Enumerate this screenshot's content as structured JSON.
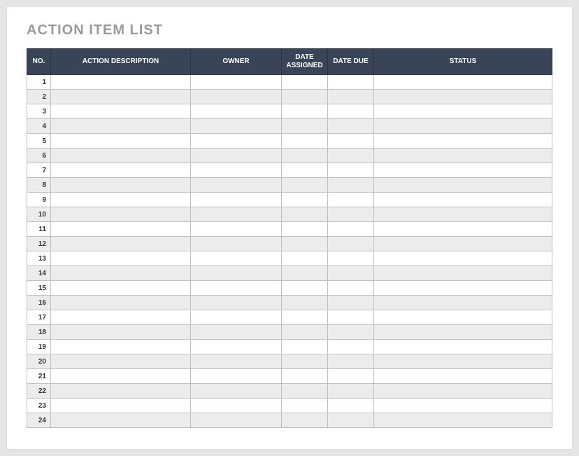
{
  "title": "ACTION ITEM LIST",
  "columns": {
    "no": "NO.",
    "description": "ACTION DESCRIPTION",
    "owner": "OWNER",
    "date_assigned": "DATE ASSIGNED",
    "date_due": "DATE DUE",
    "status": "STATUS"
  },
  "rows": [
    {
      "no": "1",
      "description": "",
      "owner": "",
      "date_assigned": "",
      "date_due": "",
      "status": ""
    },
    {
      "no": "2",
      "description": "",
      "owner": "",
      "date_assigned": "",
      "date_due": "",
      "status": ""
    },
    {
      "no": "3",
      "description": "",
      "owner": "",
      "date_assigned": "",
      "date_due": "",
      "status": ""
    },
    {
      "no": "4",
      "description": "",
      "owner": "",
      "date_assigned": "",
      "date_due": "",
      "status": ""
    },
    {
      "no": "5",
      "description": "",
      "owner": "",
      "date_assigned": "",
      "date_due": "",
      "status": ""
    },
    {
      "no": "6",
      "description": "",
      "owner": "",
      "date_assigned": "",
      "date_due": "",
      "status": ""
    },
    {
      "no": "7",
      "description": "",
      "owner": "",
      "date_assigned": "",
      "date_due": "",
      "status": ""
    },
    {
      "no": "8",
      "description": "",
      "owner": "",
      "date_assigned": "",
      "date_due": "",
      "status": ""
    },
    {
      "no": "9",
      "description": "",
      "owner": "",
      "date_assigned": "",
      "date_due": "",
      "status": ""
    },
    {
      "no": "10",
      "description": "",
      "owner": "",
      "date_assigned": "",
      "date_due": "",
      "status": ""
    },
    {
      "no": "11",
      "description": "",
      "owner": "",
      "date_assigned": "",
      "date_due": "",
      "status": ""
    },
    {
      "no": "12",
      "description": "",
      "owner": "",
      "date_assigned": "",
      "date_due": "",
      "status": ""
    },
    {
      "no": "13",
      "description": "",
      "owner": "",
      "date_assigned": "",
      "date_due": "",
      "status": ""
    },
    {
      "no": "14",
      "description": "",
      "owner": "",
      "date_assigned": "",
      "date_due": "",
      "status": ""
    },
    {
      "no": "15",
      "description": "",
      "owner": "",
      "date_assigned": "",
      "date_due": "",
      "status": ""
    },
    {
      "no": "16",
      "description": "",
      "owner": "",
      "date_assigned": "",
      "date_due": "",
      "status": ""
    },
    {
      "no": "17",
      "description": "",
      "owner": "",
      "date_assigned": "",
      "date_due": "",
      "status": ""
    },
    {
      "no": "18",
      "description": "",
      "owner": "",
      "date_assigned": "",
      "date_due": "",
      "status": ""
    },
    {
      "no": "19",
      "description": "",
      "owner": "",
      "date_assigned": "",
      "date_due": "",
      "status": ""
    },
    {
      "no": "20",
      "description": "",
      "owner": "",
      "date_assigned": "",
      "date_due": "",
      "status": ""
    },
    {
      "no": "21",
      "description": "",
      "owner": "",
      "date_assigned": "",
      "date_due": "",
      "status": ""
    },
    {
      "no": "22",
      "description": "",
      "owner": "",
      "date_assigned": "",
      "date_due": "",
      "status": ""
    },
    {
      "no": "23",
      "description": "",
      "owner": "",
      "date_assigned": "",
      "date_due": "",
      "status": ""
    },
    {
      "no": "24",
      "description": "",
      "owner": "",
      "date_assigned": "",
      "date_due": "",
      "status": ""
    }
  ]
}
